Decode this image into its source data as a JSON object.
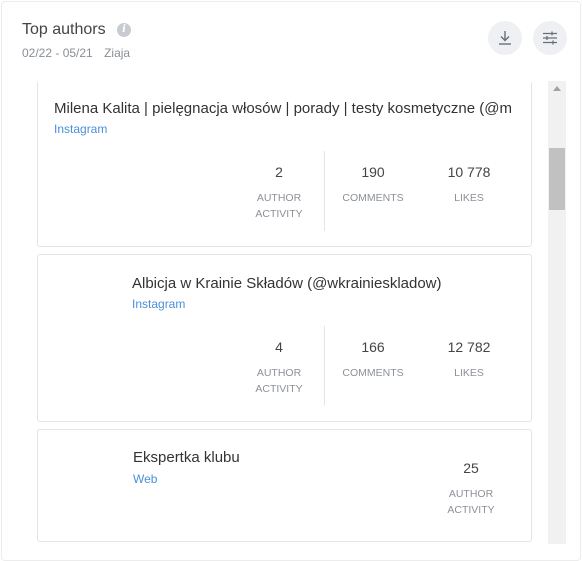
{
  "header": {
    "title": "Top authors",
    "info_icon": "i",
    "date_range": "02/22 - 05/21",
    "brand": "Ziaja"
  },
  "icons": {
    "download": "download-icon",
    "settings": "sliders-icon",
    "info": "info-icon"
  },
  "authors": [
    {
      "name": "Milena Kalita | pielęgnacja włosów | porady | testy kosmetyczne (@m",
      "source": "Instagram",
      "author_activity": "2",
      "comments": "190",
      "likes": "10 778"
    },
    {
      "name": "Albicja w Krainie Składów (@wkrainieskladow)",
      "source": "Instagram",
      "author_activity": "4",
      "comments": "166",
      "likes": "12 782"
    },
    {
      "name": "Ekspertka klubu",
      "source": "Web",
      "author_activity": "25"
    }
  ],
  "labels": {
    "author_activity_1": "AUTHOR",
    "author_activity_2": "ACTIVITY",
    "comments": "COMMENTS",
    "likes": "LIKES"
  },
  "colors": {
    "link": "#4a90d9",
    "border": "#e3e5e8",
    "button_bg": "#eef0f3"
  }
}
